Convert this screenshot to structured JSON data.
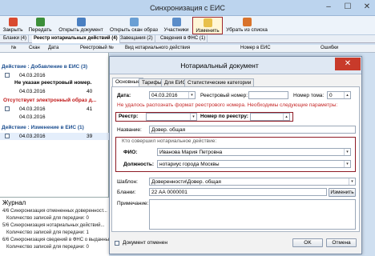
{
  "window": {
    "title": "Синхронизация с ЕИС",
    "min": "–",
    "max": "☐",
    "close": "✕"
  },
  "toolbar": {
    "close": "Закрыть",
    "send": "Передать",
    "open_doc": "Открыть документ",
    "open_scan": "Открыть скан образ",
    "participants": "Участники",
    "edit": "Изменить",
    "remove": "Убрать из списка",
    "colors": {
      "close": "#d94a2f",
      "send": "#3c8f3a",
      "open_doc": "#4a7fc1",
      "open_scan": "#6a9fd4",
      "participants": "#5b8dc9",
      "edit": "#e8c04a",
      "remove": "#d9732c"
    }
  },
  "main_tabs": [
    "Бланки (4)",
    "Реестр нотариальных действий (4)",
    "Завещания (2)",
    "Сведения в ФНС (1)"
  ],
  "grid": {
    "headers": [
      "№",
      "Скан",
      "Дата",
      "Реестровый №",
      "Вид нотариального действия",
      "Номер в ЕИС",
      "Ошибки"
    ],
    "groups": [
      {
        "label": "Действие : Добавление в ЕИС (3)",
        "color": "#1a4d8f"
      },
      {
        "label": "Не указан реестровый номер.",
        "color": "#000000"
      },
      {
        "label": "Отсутствует электронный образ д...",
        "color": "#c01818"
      },
      {
        "label": "Действие : Изменение в ЕИС (1)",
        "color": "#1a4d8f"
      }
    ],
    "rows": [
      {
        "date": "04.03.2016",
        "num": ""
      },
      {
        "date": "04.03.2016",
        "num": "40"
      },
      {
        "date": "04.03.2016",
        "num": "41"
      },
      {
        "date": "04.03.2016",
        "num": ""
      },
      {
        "date": "04.03.2016",
        "num": "39"
      }
    ]
  },
  "journal": {
    "title": "Журнал",
    "lines": [
      "4/6 Синхронизация отмененных доверенност...",
      "Количество записей для передачи: 0",
      "5/6 Синхронизация нотариальных действий...",
      "Количество записей для передачи: 1",
      "6/6 Синхронизация сведений в ФНС о выданных...",
      "Количество записей для передачи: 0"
    ]
  },
  "dialog": {
    "title": "Нотариальный документ",
    "close": "✕",
    "tabs": [
      "Основные",
      "Тарифы",
      "Для ЕИС",
      "Статистические категории"
    ],
    "date_label": "Дата:",
    "date_value": "04.03.2016",
    "regnum_label": "Реестровый номер:",
    "regnum_value": "",
    "volume_label": "Номер тома:",
    "volume_value": "0",
    "warning": "Не удалось распознать формат реестрового номера. Необходимы следующие параметры:",
    "registry_label": "Реестр:",
    "registry_value": "",
    "regno_label": "Номер по реестру:",
    "regno_value": "",
    "name_label": "Название:",
    "name_value": "Довер. общая",
    "performer_caption": "Кто совершил нотариальное действие:",
    "fio_label": "ФИО:",
    "fio_value": "Иванова Мария Петровна",
    "position_label": "Должность:",
    "position_value": "нотариус города Москвы",
    "template_label": "Шаблон:",
    "template_value": "Доверенности\\Довер. общая",
    "blanks_label": "Бланки:",
    "blanks_value": "22 АА 0000001",
    "change_button": "Изменить",
    "note_label": "Примечание:",
    "note_value": "",
    "cancelled_label": "Документ отменен",
    "ok_button": "OK",
    "cancel_button": "Отмена"
  }
}
